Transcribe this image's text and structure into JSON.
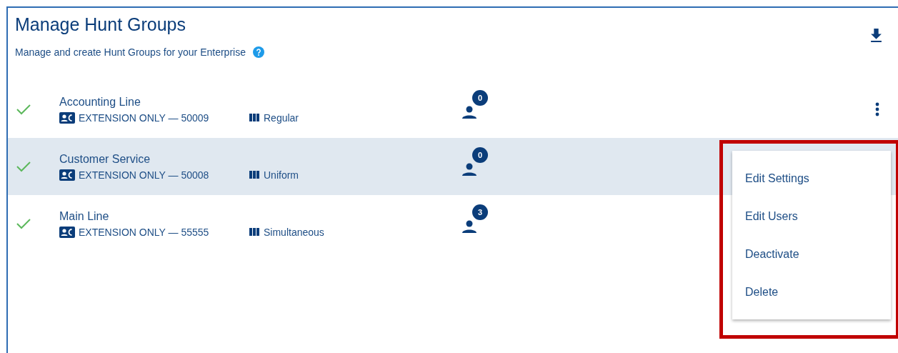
{
  "header": {
    "title": "Manage Hunt Groups",
    "subtitle": "Manage and create Hunt Groups for your Enterprise"
  },
  "hunt_groups": [
    {
      "name": "Accounting Line",
      "active": true,
      "number": "EXTENSION ONLY — 50009",
      "policy": "Regular",
      "user_count": "0",
      "selected": false,
      "menu_button": true
    },
    {
      "name": "Customer Service",
      "active": true,
      "number": "EXTENSION ONLY — 50008",
      "policy": "Uniform",
      "user_count": "0",
      "selected": true
    },
    {
      "name": "Main Line",
      "active": true,
      "number": "EXTENSION ONLY — 55555",
      "policy": "Simultaneous",
      "user_count": "3",
      "selected": false
    }
  ],
  "context_menu": {
    "highlighted": true,
    "items": [
      "Edit Settings",
      "Edit Users",
      "Deactivate",
      "Delete"
    ]
  }
}
